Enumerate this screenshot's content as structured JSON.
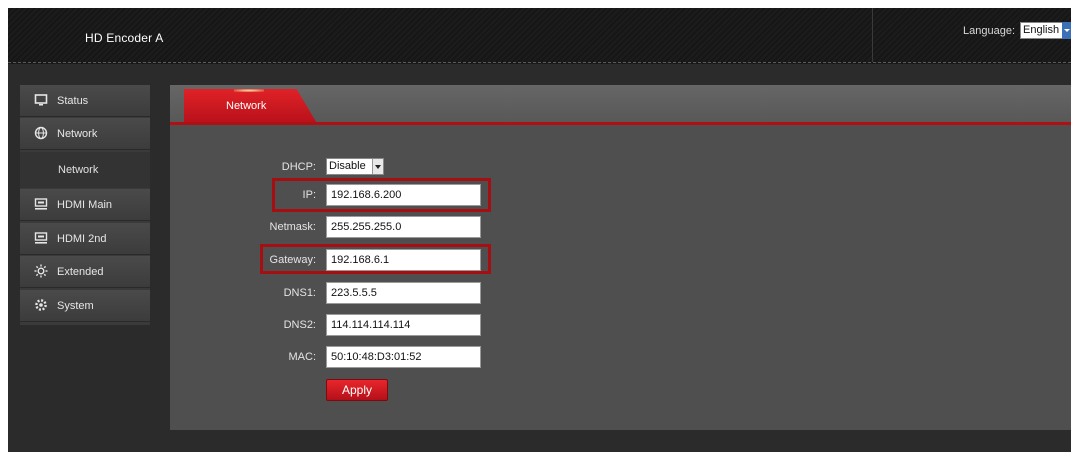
{
  "header": {
    "title": "HD Encoder  A",
    "language_label": "Language:",
    "language_value": "English"
  },
  "sidebar": {
    "items": [
      {
        "label": "Status",
        "icon": "monitor-icon"
      },
      {
        "label": "Network",
        "icon": "globe-icon"
      },
      {
        "label": "Network",
        "sub": true
      },
      {
        "label": "HDMI Main",
        "icon": "hdmi-icon"
      },
      {
        "label": "HDMI 2nd",
        "icon": "hdmi-icon"
      },
      {
        "label": "Extended",
        "icon": "sun-gear-icon"
      },
      {
        "label": "System",
        "icon": "gear-icon"
      }
    ]
  },
  "main": {
    "tab_label": "Network",
    "form": {
      "dhcp": {
        "label": "DHCP:",
        "value": "Disable"
      },
      "ip": {
        "label": "IP:",
        "value": "192.168.6.200"
      },
      "netmask": {
        "label": "Netmask:",
        "value": "255.255.255.0"
      },
      "gateway": {
        "label": "Gateway:",
        "value": "192.168.6.1"
      },
      "dns1": {
        "label": "DNS1:",
        "value": "223.5.5.5"
      },
      "dns2": {
        "label": "DNS2:",
        "value": "114.114.114.114"
      },
      "mac": {
        "label": "MAC:",
        "value": "50:10:48:D3:01:52"
      }
    },
    "apply_label": "Apply"
  },
  "colors": {
    "accent_red": "#d01a20",
    "highlight_border": "#a50f12",
    "background": "#2b2b2b"
  }
}
